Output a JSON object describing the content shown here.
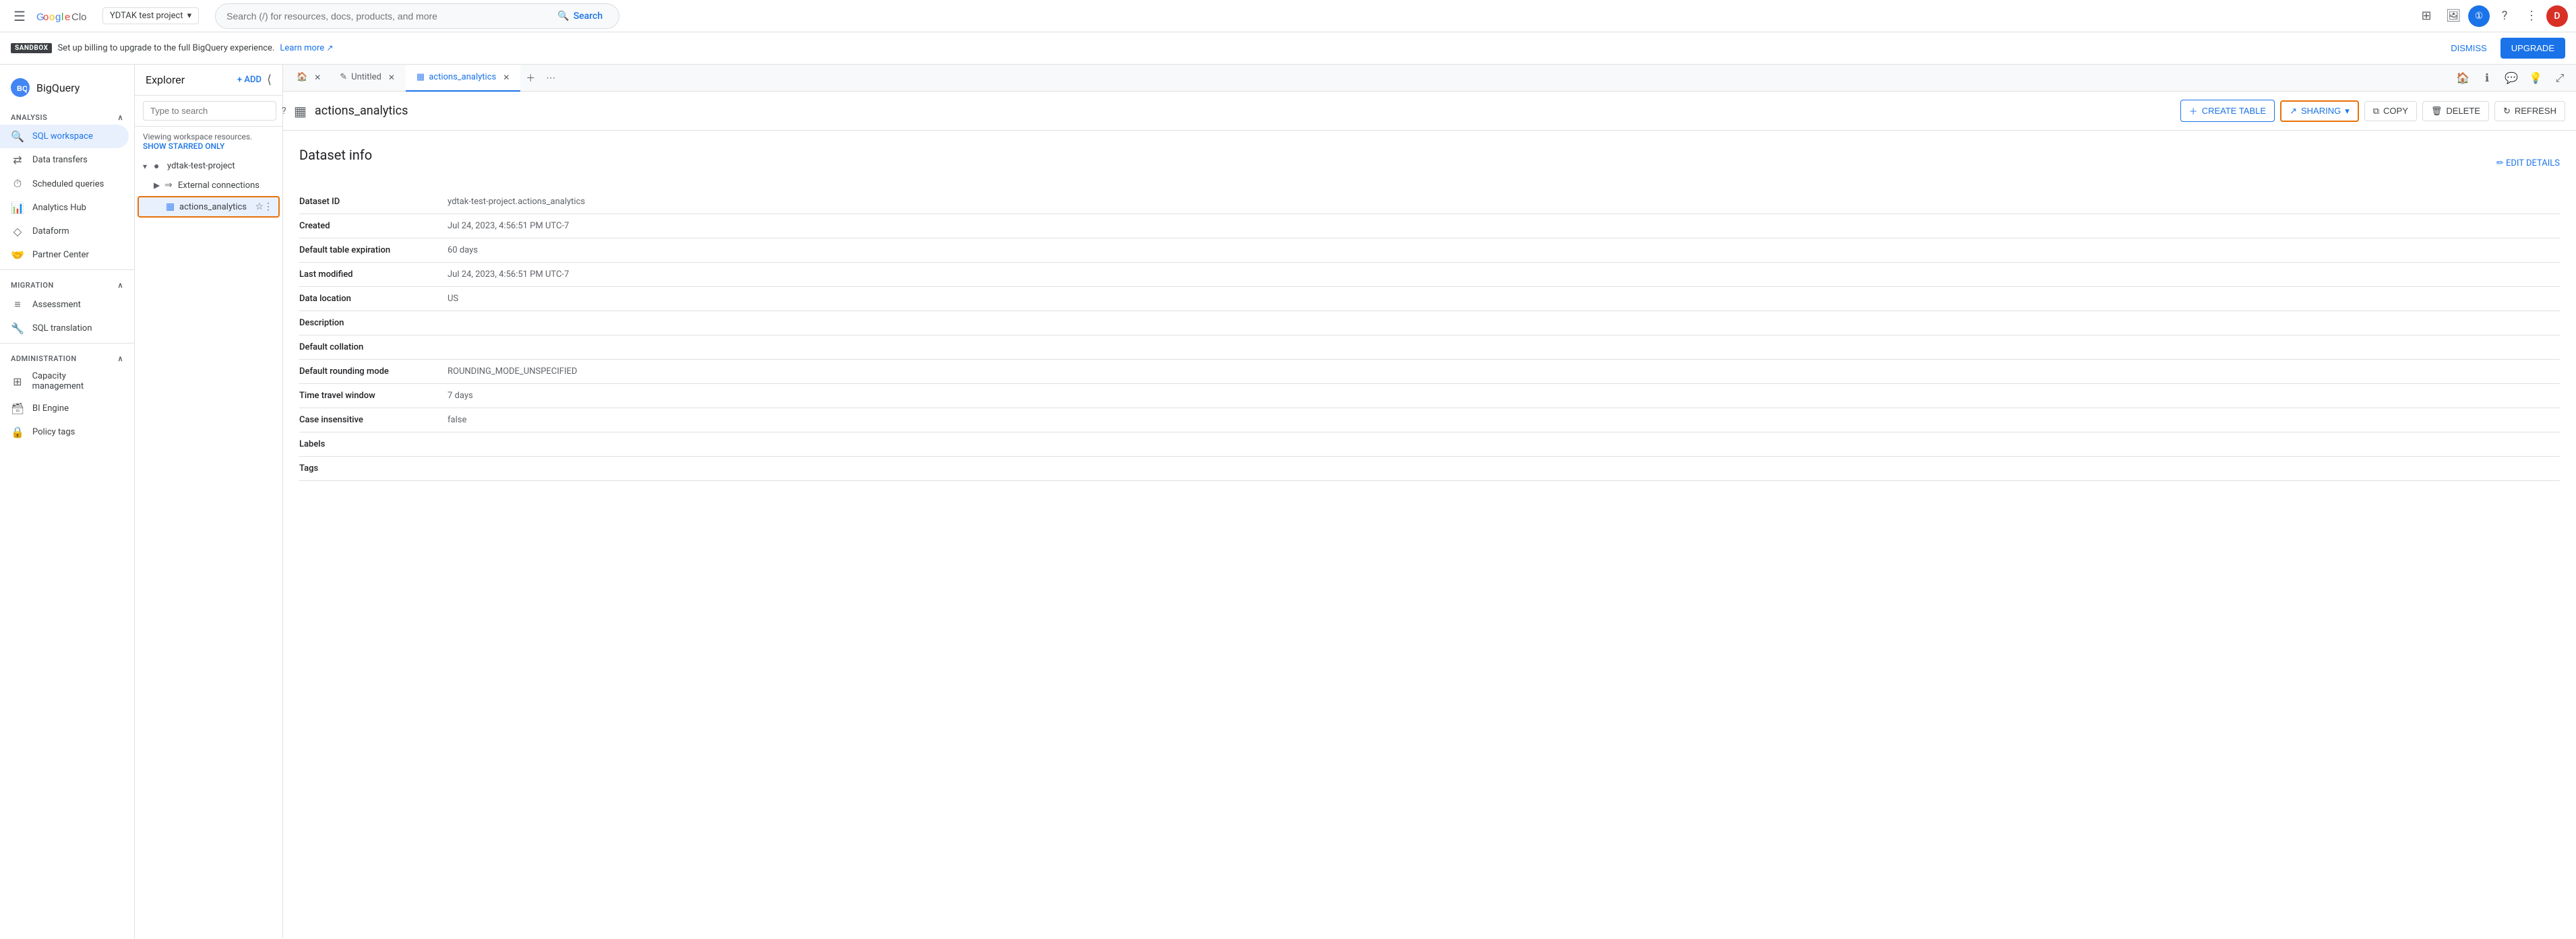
{
  "topNav": {
    "menuIcon": "☰",
    "logoText": "Google Cloud",
    "projectSelector": {
      "label": "YDTAK test project",
      "chevron": "▾"
    },
    "search": {
      "placeholder": "Search (/) for resources, docs, products, and more",
      "buttonLabel": "Search"
    },
    "icons": [
      "⊞",
      "🖼",
      "①",
      "?",
      "⋮",
      "D"
    ]
  },
  "banner": {
    "badge": "SANDBOX",
    "text": "Set up billing to upgrade to the full BigQuery experience.",
    "learnMore": "Learn more",
    "dismiss": "DISMISS",
    "upgrade": "UPGRADE"
  },
  "sidebar": {
    "appName": "BigQuery",
    "sections": [
      {
        "label": "Analysis",
        "collapsed": false,
        "items": [
          {
            "id": "sql-workspace",
            "label": "SQL workspace",
            "icon": "🔍",
            "active": true
          },
          {
            "id": "data-transfers",
            "label": "Data transfers",
            "icon": "⇄"
          },
          {
            "id": "scheduled-queries",
            "label": "Scheduled queries",
            "icon": "⏱"
          },
          {
            "id": "analytics-hub",
            "label": "Analytics Hub",
            "icon": "📊"
          },
          {
            "id": "dataform",
            "label": "Dataform",
            "icon": "◇"
          },
          {
            "id": "partner-center",
            "label": "Partner Center",
            "icon": "🤝"
          }
        ]
      },
      {
        "label": "Migration",
        "collapsed": false,
        "items": [
          {
            "id": "assessment",
            "label": "Assessment",
            "icon": "≡"
          },
          {
            "id": "sql-translation",
            "label": "SQL translation",
            "icon": "🔧"
          }
        ]
      },
      {
        "label": "Administration",
        "collapsed": false,
        "items": [
          {
            "id": "capacity-management",
            "label": "Capacity management",
            "icon": "⊞"
          },
          {
            "id": "bi-engine",
            "label": "BI Engine",
            "icon": "🗃"
          },
          {
            "id": "policy-tags",
            "label": "Policy tags",
            "icon": "🔒"
          }
        ]
      }
    ]
  },
  "explorer": {
    "title": "Explorer",
    "addLabel": "+ ADD",
    "searchPlaceholder": "Type to search",
    "workspaceText": "Viewing workspace resources.",
    "showStarred": "SHOW STARRED ONLY",
    "project": {
      "name": "ydtak-test-project",
      "items": [
        {
          "id": "external-connections",
          "label": "External connections",
          "icon": "⇒",
          "expanded": false
        },
        {
          "id": "actions-analytics",
          "label": "actions_analytics",
          "icon": "▦",
          "selected": true
        }
      ]
    }
  },
  "tabs": [
    {
      "id": "home",
      "icon": "🏠",
      "type": "home"
    },
    {
      "id": "untitled",
      "label": "Untitled",
      "icon": "✎",
      "closeable": true,
      "active": false
    },
    {
      "id": "actions-analytics",
      "label": "actions_analytics",
      "icon": "▦",
      "closeable": true,
      "active": true
    }
  ],
  "tabActions": [
    {
      "id": "tab-add",
      "icon": "+"
    },
    {
      "id": "tab-menu",
      "icon": "⋯"
    }
  ],
  "tabRightIcons": [
    {
      "id": "home-icon",
      "icon": "🏠"
    },
    {
      "id": "info-icon",
      "icon": "ℹ"
    },
    {
      "id": "chat-icon",
      "icon": "💬"
    },
    {
      "id": "bulb-icon",
      "icon": "💡"
    },
    {
      "id": "expand-icon",
      "icon": "⤢"
    }
  ],
  "dataset": {
    "icon": "▦",
    "name": "actions_analytics",
    "toolbarButtons": [
      {
        "id": "create-table",
        "label": "CREATE TABLE",
        "icon": "＋",
        "style": "primary"
      },
      {
        "id": "sharing",
        "label": "SHARING",
        "icon": "↗",
        "style": "sharing",
        "dropdown": true
      },
      {
        "id": "copy",
        "label": "COPY",
        "icon": "⧉",
        "style": "normal"
      },
      {
        "id": "delete",
        "label": "DELETE",
        "icon": "🗑",
        "style": "normal"
      },
      {
        "id": "refresh",
        "label": "REFRESH",
        "icon": "↻",
        "style": "normal"
      }
    ],
    "editDetailsLabel": "✏ EDIT DETAILS",
    "infoTitle": "Dataset info",
    "fields": [
      {
        "label": "Dataset ID",
        "value": "ydtak-test-project.actions_analytics"
      },
      {
        "label": "Created",
        "value": "Jul 24, 2023, 4:56:51 PM UTC-7"
      },
      {
        "label": "Default table expiration",
        "value": "60 days"
      },
      {
        "label": "Last modified",
        "value": "Jul 24, 2023, 4:56:51 PM UTC-7"
      },
      {
        "label": "Data location",
        "value": "US"
      },
      {
        "label": "Description",
        "value": ""
      },
      {
        "label": "Default collation",
        "value": ""
      },
      {
        "label": "Default rounding mode",
        "value": "ROUNDING_MODE_UNSPECIFIED"
      },
      {
        "label": "Time travel window",
        "value": "7 days"
      },
      {
        "label": "Case insensitive",
        "value": "false"
      },
      {
        "label": "Labels",
        "value": ""
      },
      {
        "label": "Tags",
        "value": ""
      }
    ]
  }
}
